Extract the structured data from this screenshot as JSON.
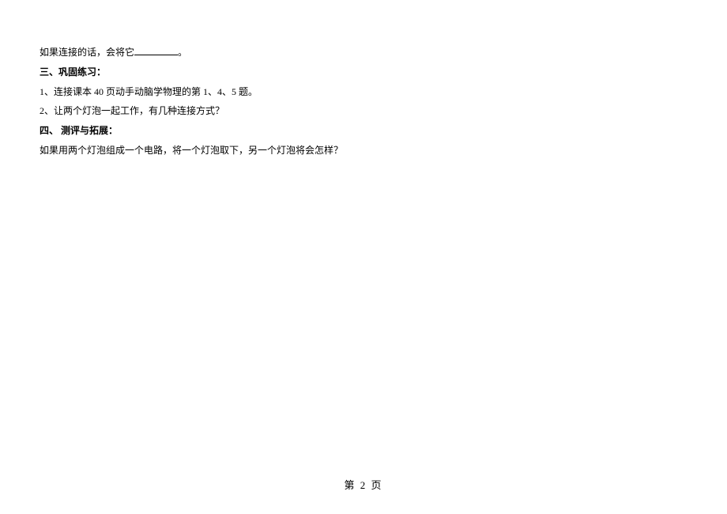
{
  "content": {
    "line1_part1": "如果连接的话，会将它",
    "line1_part2": "。",
    "heading3": "三、巩固练习：",
    "item3_1": "1、连接课本 40 页动手动脑学物理的第 1、4、5 题。",
    "item3_2": "2、让两个灯泡一起工作，有几种连接方式？",
    "heading4": "四、 测评与拓展：",
    "item4_1": "如果用两个灯泡组成一个电路，将一个灯泡取下，另一个灯泡将会怎样？"
  },
  "footer": {
    "page_label": "第 2 页"
  }
}
